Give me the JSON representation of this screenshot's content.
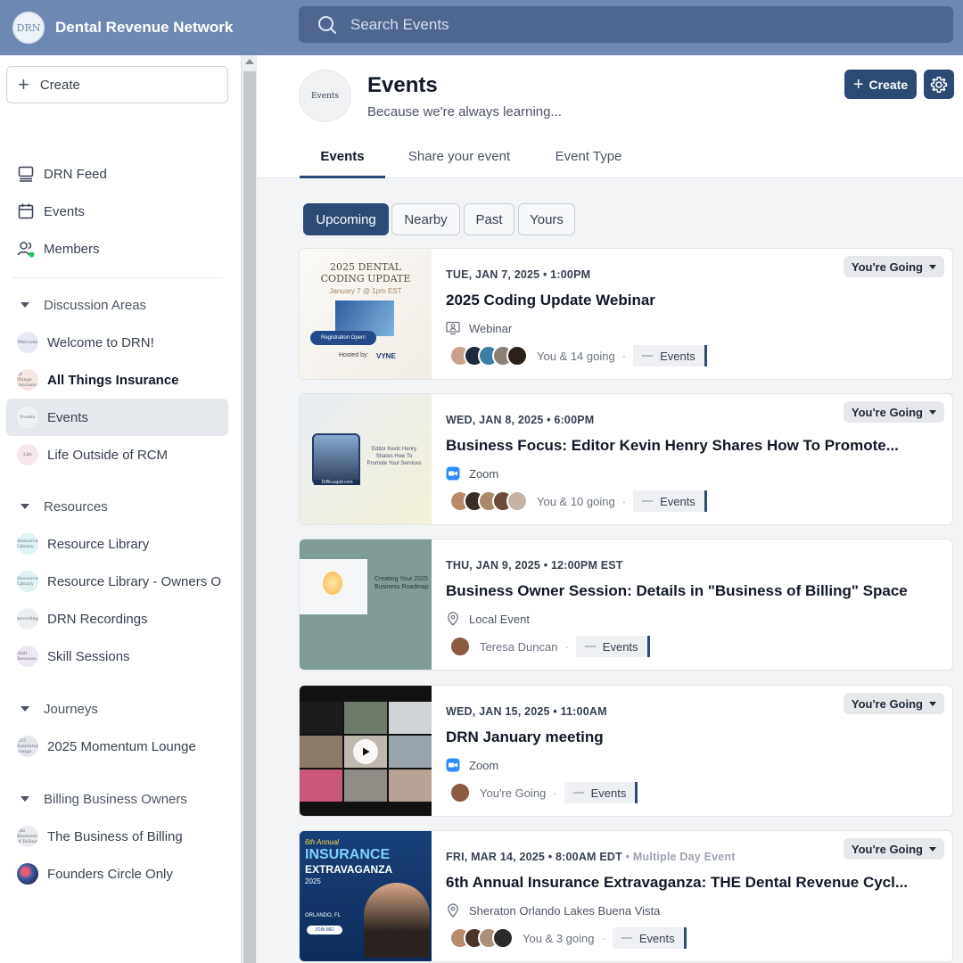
{
  "app": {
    "brand_name": "Dental Revenue Network",
    "brand_logo_text": "DRN"
  },
  "search": {
    "placeholder": "Search Events"
  },
  "sidebar": {
    "create_label": "Create",
    "main_items": [
      {
        "label": "DRN Feed",
        "icon": "feed-icon"
      },
      {
        "label": "Events",
        "icon": "calendar-icon"
      },
      {
        "label": "Members",
        "icon": "members-icon"
      }
    ],
    "sections": [
      {
        "title": "Discussion Areas",
        "items": [
          {
            "label": "Welcome to DRN!",
            "thumb_text": "Welcome"
          },
          {
            "label": "All Things Insurance",
            "thumb_text": "All Things Insurance"
          },
          {
            "label": "Events",
            "thumb_text": "Events"
          },
          {
            "label": "Life Outside of RCM",
            "thumb_text": "Life"
          }
        ]
      },
      {
        "title": "Resources",
        "items": [
          {
            "label": "Resource Library",
            "thumb_text": "Resource Library"
          },
          {
            "label": "Resource Library - Owners Only",
            "thumb_text": "Resource Library"
          },
          {
            "label": "DRN Recordings",
            "thumb_text": "Recordings"
          },
          {
            "label": "Skill Sessions",
            "thumb_text": "Skill Sessions"
          }
        ]
      },
      {
        "title": "Journeys",
        "items": [
          {
            "label": "2025 Momentum Lounge",
            "thumb_text": "2025 Momentum Lounge"
          }
        ]
      },
      {
        "title": "Billing Business Owners",
        "items": [
          {
            "label": "The Business of Billing",
            "thumb_text": "The Business of Billing"
          },
          {
            "label": "Founders Circle Only",
            "thumb_text": ""
          }
        ]
      }
    ]
  },
  "header": {
    "avatar_text": "Events",
    "title": "Events",
    "subtitle": "Because we're always learning...",
    "create_label": "Create",
    "tabs": [
      "Events",
      "Share your event",
      "Event Type"
    ]
  },
  "filters": [
    "Upcoming",
    "Nearby",
    "Past",
    "Yours"
  ],
  "events": [
    {
      "date": "TUE, JAN 7, 2025 • 1:00PM",
      "extra": "",
      "title": "2025 Coding Update Webinar",
      "location": "Webinar",
      "location_icon": "webinar-icon",
      "attendees": "You & 14 going",
      "space": "Events",
      "rsvp": "You're Going",
      "image": {
        "line1": "2025 DENTAL",
        "line2": "CODING UPDATE",
        "line3": "January 7 @ 1pm EST",
        "badge": "Registration Open!",
        "hosted": "Hosted by:",
        "sponsor": "VYNE"
      }
    },
    {
      "date": "WED, JAN 8, 2025 • 6:00PM",
      "extra": "",
      "title": "Business Focus: Editor Kevin Henry Shares How To Promote...",
      "location": "Zoom",
      "location_icon": "zoom-icon",
      "attendees": "You & 10 going",
      "space": "Events",
      "rsvp": "You're Going",
      "image": {
        "caption": "Editor Kevin Henry Shares How To Promote Your Services",
        "tag": "DrBicuspid.com"
      }
    },
    {
      "date": "THU, JAN 9, 2025 • 12:00PM EST",
      "extra": "",
      "title": "Business Owner Session: Details in \"Business of Billing\" Space",
      "location": "Local Event",
      "location_icon": "pin-icon",
      "attendees": "Teresa Duncan",
      "space": "Events",
      "rsvp": "",
      "image": {
        "caption": "Creating Your 2025 Business Roadmap"
      }
    },
    {
      "date": "WED, JAN 15, 2025 • 11:00AM",
      "extra": "",
      "title": "DRN January meeting",
      "location": "Zoom",
      "location_icon": "zoom-icon",
      "attendees": "You're Going",
      "space": "Events",
      "rsvp": "You're Going",
      "image": {}
    },
    {
      "date": "FRI, MAR 14, 2025 • 8:00AM EDT",
      "extra": "• Multiple Day Event",
      "title": "6th Annual Insurance Extravaganza: THE Dental Revenue Cycl...",
      "location": "Sheraton Orlando Lakes Buena Vista",
      "location_icon": "pin-icon",
      "attendees": "You & 3 going",
      "space": "Events",
      "rsvp": "You're Going",
      "image": {
        "line1": "6th Annual",
        "line2": "INSURANCE",
        "line3": "EXTRAVAGANZA",
        "line4": "2025",
        "place": "ORLANDO, FL",
        "cta": "JOIN ME!"
      }
    }
  ],
  "colors": {
    "topbar": "#6f88b3",
    "search": "#4f6790",
    "accent": "#2c4a74",
    "zoom": "#2d8cff"
  }
}
